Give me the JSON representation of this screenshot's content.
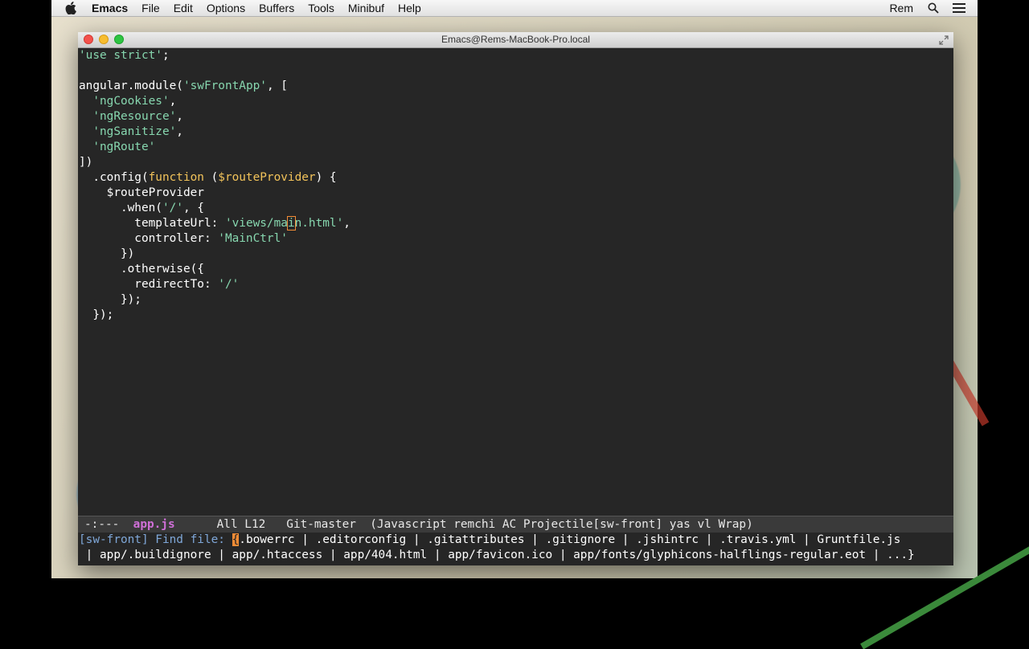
{
  "menubar": {
    "app_name": "Emacs",
    "items": [
      "File",
      "Edit",
      "Options",
      "Buffers",
      "Tools",
      "Minibuf",
      "Help"
    ],
    "user": "Rem",
    "icons": [
      "apple-icon",
      "search-icon",
      "list-icon"
    ]
  },
  "window": {
    "title": "Emacs@Rems-MacBook-Pro.local"
  },
  "editor": {
    "lines": [
      [
        {
          "t": "'use strict'",
          "c": "str"
        },
        {
          "t": ";"
        }
      ],
      [],
      [
        {
          "t": "angular.module("
        },
        {
          "t": "'swFrontApp'",
          "c": "str"
        },
        {
          "t": ", ["
        }
      ],
      [
        {
          "t": "  "
        },
        {
          "t": "'ngCookies'",
          "c": "str"
        },
        {
          "t": ","
        }
      ],
      [
        {
          "t": "  "
        },
        {
          "t": "'ngResource'",
          "c": "str"
        },
        {
          "t": ","
        }
      ],
      [
        {
          "t": "  "
        },
        {
          "t": "'ngSanitize'",
          "c": "str"
        },
        {
          "t": ","
        }
      ],
      [
        {
          "t": "  "
        },
        {
          "t": "'ngRoute'",
          "c": "str"
        }
      ],
      [
        {
          "t": "])"
        }
      ],
      [
        {
          "t": "  .config("
        },
        {
          "t": "function",
          "c": "kw"
        },
        {
          "t": " ("
        },
        {
          "t": "$routeProvider",
          "c": "kw"
        },
        {
          "t": ") {"
        }
      ],
      [
        {
          "t": "    $routeProvider"
        }
      ],
      [
        {
          "t": "      .when("
        },
        {
          "t": "'/'",
          "c": "str"
        },
        {
          "t": ", {"
        }
      ],
      [
        {
          "t": "        templateUrl: "
        },
        {
          "t": "'views/ma",
          "c": "str"
        },
        {
          "t": "i",
          "c": "str cursor"
        },
        {
          "t": "n.html'",
          "c": "str"
        },
        {
          "t": ","
        }
      ],
      [
        {
          "t": "        controller: "
        },
        {
          "t": "'MainCtrl'",
          "c": "str"
        }
      ],
      [
        {
          "t": "      })"
        }
      ],
      [
        {
          "t": "      .otherwise({"
        }
      ],
      [
        {
          "t": "        redirectTo: "
        },
        {
          "t": "'/'",
          "c": "str"
        }
      ],
      [
        {
          "t": "      });"
        }
      ],
      [
        {
          "t": "  });"
        }
      ]
    ]
  },
  "modeline": {
    "status": "-:---",
    "buffer": "app.js",
    "position": "All L12",
    "vc": "Git-master",
    "modes": "(Javascript remchi AC Projectile[sw-front] yas vl Wrap)"
  },
  "minibuffer": {
    "prompt": "[sw-front] Find file: ",
    "open_brace": "{",
    "line1_rest": ".bowerrc | .editorconfig | .gitattributes | .gitignore | .jshintrc | .travis.yml | Gruntfile.js",
    "line2": "| app/.buildignore | app/.htaccess | app/404.html | app/favicon.ico | app/fonts/glyphicons-halflings-regular.eot | ...}"
  }
}
